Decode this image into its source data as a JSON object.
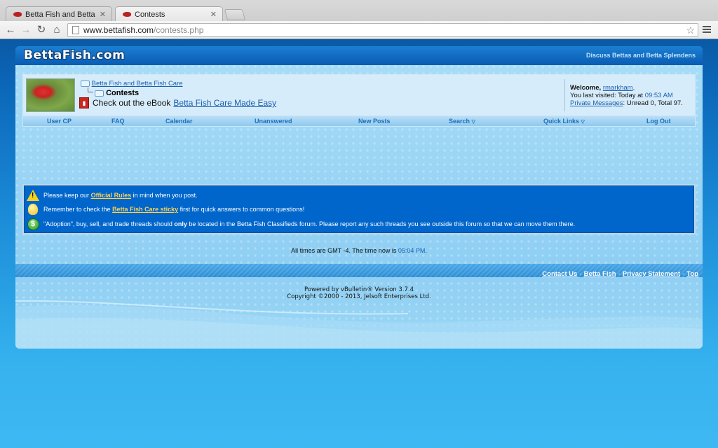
{
  "browser": {
    "tabs": [
      {
        "title": "Betta Fish and Betta Fish C",
        "active": false
      },
      {
        "title": "Contests",
        "active": true
      }
    ],
    "url_host": "www.bettafish.com",
    "url_path": "/contests.php"
  },
  "site": {
    "logo": "BettaFish.com",
    "tagline": "Discuss Bettas and Betta Splendens"
  },
  "breadcrumb": {
    "parent": "Betta Fish and Betta Fish Care",
    "current": "Contests"
  },
  "ebook": {
    "prefix": "Check out the eBook",
    "link": "Betta Fish Care Made Easy",
    "icon": "pdf-icon"
  },
  "user": {
    "welcome_prefix": "Welcome,",
    "username": "rmarkham",
    "last_visited_prefix": "You last visited: Today at",
    "last_visited_time": "09:53 AM",
    "pm_link": "Private Messages",
    "pm_status": ": Unread 0, Total 97."
  },
  "navbar": {
    "items": [
      "User CP",
      "FAQ",
      "Calendar",
      "Unanswered",
      "New Posts",
      "Search",
      "Quick Links",
      "Log Out"
    ]
  },
  "notices": {
    "rules_pre": "Please keep our",
    "rules_link": "Official Rules",
    "rules_post": "in mind when you post.",
    "sticky_pre": "Remember to check the",
    "sticky_link": "Betta Fish Care sticky",
    "sticky_post": "first for quick answers to common questions!",
    "adopt_pre": "\"Adoption\", buy, sell, and trade threads should",
    "adopt_bold": "only",
    "adopt_post": "be located in the Betta Fish Classifieds forum. Please report any such threads you see outside this forum so that we can move them there."
  },
  "timeinfo": {
    "prefix": "All times are GMT -4. The time now is",
    "time": "05:04 PM",
    "suffix": "."
  },
  "footer": {
    "links": [
      "Contact Us",
      "Betta Fish",
      "Privacy Statement",
      "Top"
    ],
    "powered": "Powered by vBulletin® Version 3.7.4",
    "copyright": "Copyright ©2000 - 2013, Jelsoft Enterprises Ltd."
  }
}
